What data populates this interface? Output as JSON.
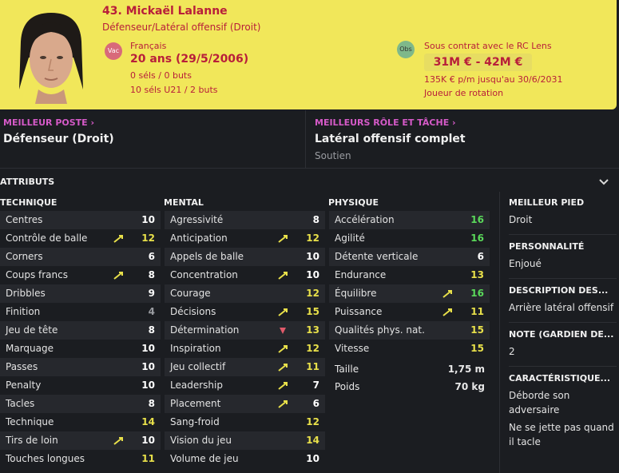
{
  "player": {
    "name": "43. Mickaël Lalanne",
    "role": "Défenseur/Latéral offensif (Droit)",
    "badge_vac": "Vac",
    "badge_obs": "Obs",
    "nationality": "Français",
    "age": "20 ans (29/5/2006)",
    "caps_senior": "0 séls / 0 buts",
    "caps_u21": "10 séls U21 / 2 buts",
    "contract": "Sous contrat avec le RC Lens",
    "value": "31M € - 42M €",
    "wage": "135K € p/m jusqu'au 30/6/2031",
    "squad_status": "Joueur de rotation"
  },
  "best_position": {
    "label": "MEILLEUR POSTE ›",
    "value": "Défenseur (Droit)"
  },
  "best_role": {
    "label": "MEILLEURS RÔLE ET TÂCHE ›",
    "value": "Latéral offensif complet",
    "duty": "Soutien"
  },
  "attributes_title": "ATTRIBUTS",
  "columns": {
    "technique": "TECHNIQUE",
    "mental": "MENTAL",
    "physique": "PHYSIQUE"
  },
  "colors": {
    "white": "#ffffff",
    "grey": "#9a9ca1",
    "yellow": "#e8e04a",
    "green": "#5ad85a",
    "arrow_up": "#e8e04a",
    "arrow_down": "#e05a6a"
  },
  "technique": [
    {
      "label": "Centres",
      "value": "10",
      "arrow": "",
      "tone": "white"
    },
    {
      "label": "Contrôle de balle",
      "value": "12",
      "arrow": "up",
      "tone": "yellow"
    },
    {
      "label": "Corners",
      "value": "6",
      "arrow": "",
      "tone": "white"
    },
    {
      "label": "Coups francs",
      "value": "8",
      "arrow": "up",
      "tone": "white"
    },
    {
      "label": "Dribbles",
      "value": "9",
      "arrow": "",
      "tone": "white"
    },
    {
      "label": "Finition",
      "value": "4",
      "arrow": "",
      "tone": "grey"
    },
    {
      "label": "Jeu de tête",
      "value": "8",
      "arrow": "",
      "tone": "white"
    },
    {
      "label": "Marquage",
      "value": "10",
      "arrow": "",
      "tone": "white"
    },
    {
      "label": "Passes",
      "value": "10",
      "arrow": "",
      "tone": "white"
    },
    {
      "label": "Penalty",
      "value": "10",
      "arrow": "",
      "tone": "white"
    },
    {
      "label": "Tacles",
      "value": "8",
      "arrow": "",
      "tone": "white"
    },
    {
      "label": "Technique",
      "value": "14",
      "arrow": "",
      "tone": "yellow"
    },
    {
      "label": "Tirs de loin",
      "value": "10",
      "arrow": "up",
      "tone": "white"
    },
    {
      "label": "Touches longues",
      "value": "11",
      "arrow": "",
      "tone": "yellow"
    }
  ],
  "mental": [
    {
      "label": "Agressivité",
      "value": "8",
      "arrow": "",
      "tone": "white"
    },
    {
      "label": "Anticipation",
      "value": "12",
      "arrow": "up",
      "tone": "yellow"
    },
    {
      "label": "Appels de balle",
      "value": "10",
      "arrow": "",
      "tone": "white"
    },
    {
      "label": "Concentration",
      "value": "10",
      "arrow": "up",
      "tone": "white"
    },
    {
      "label": "Courage",
      "value": "12",
      "arrow": "",
      "tone": "yellow"
    },
    {
      "label": "Décisions",
      "value": "15",
      "arrow": "up",
      "tone": "yellow"
    },
    {
      "label": "Détermination",
      "value": "13",
      "arrow": "down",
      "tone": "yellow"
    },
    {
      "label": "Inspiration",
      "value": "12",
      "arrow": "up",
      "tone": "yellow"
    },
    {
      "label": "Jeu collectif",
      "value": "11",
      "arrow": "up",
      "tone": "yellow"
    },
    {
      "label": "Leadership",
      "value": "7",
      "arrow": "up",
      "tone": "white"
    },
    {
      "label": "Placement",
      "value": "6",
      "arrow": "up",
      "tone": "white"
    },
    {
      "label": "Sang-froid",
      "value": "12",
      "arrow": "",
      "tone": "yellow"
    },
    {
      "label": "Vision du jeu",
      "value": "14",
      "arrow": "",
      "tone": "yellow"
    },
    {
      "label": "Volume de jeu",
      "value": "10",
      "arrow": "",
      "tone": "white"
    }
  ],
  "physique": [
    {
      "label": "Accélération",
      "value": "16",
      "arrow": "",
      "tone": "green"
    },
    {
      "label": "Agilité",
      "value": "16",
      "arrow": "",
      "tone": "green"
    },
    {
      "label": "Détente verticale",
      "value": "6",
      "arrow": "",
      "tone": "white"
    },
    {
      "label": "Endurance",
      "value": "13",
      "arrow": "",
      "tone": "yellow"
    },
    {
      "label": "Équilibre",
      "value": "16",
      "arrow": "up",
      "tone": "green"
    },
    {
      "label": "Puissance",
      "value": "11",
      "arrow": "up",
      "tone": "yellow"
    },
    {
      "label": "Qualités phys. nat.",
      "value": "15",
      "arrow": "",
      "tone": "yellow"
    },
    {
      "label": "Vitesse",
      "value": "15",
      "arrow": "",
      "tone": "yellow"
    }
  ],
  "physical_info": {
    "height_label": "Taille",
    "height": "1,75 m",
    "weight_label": "Poids",
    "weight": "70 kg"
  },
  "side_panel": {
    "foot_title": "MEILLEUR PIED",
    "foot": "Droit",
    "personality_title": "PERSONNALITÉ",
    "personality": "Enjoué",
    "description_title": "DESCRIPTION DES...",
    "description": "Arrière latéral offensif",
    "note_title": "NOTE (GARDIEN DE...",
    "note": "2",
    "traits_title": "CARACTÉRISTIQUE...",
    "trait1": "Déborde son adversaire",
    "trait2": "Ne se jette pas quand il tacle"
  }
}
